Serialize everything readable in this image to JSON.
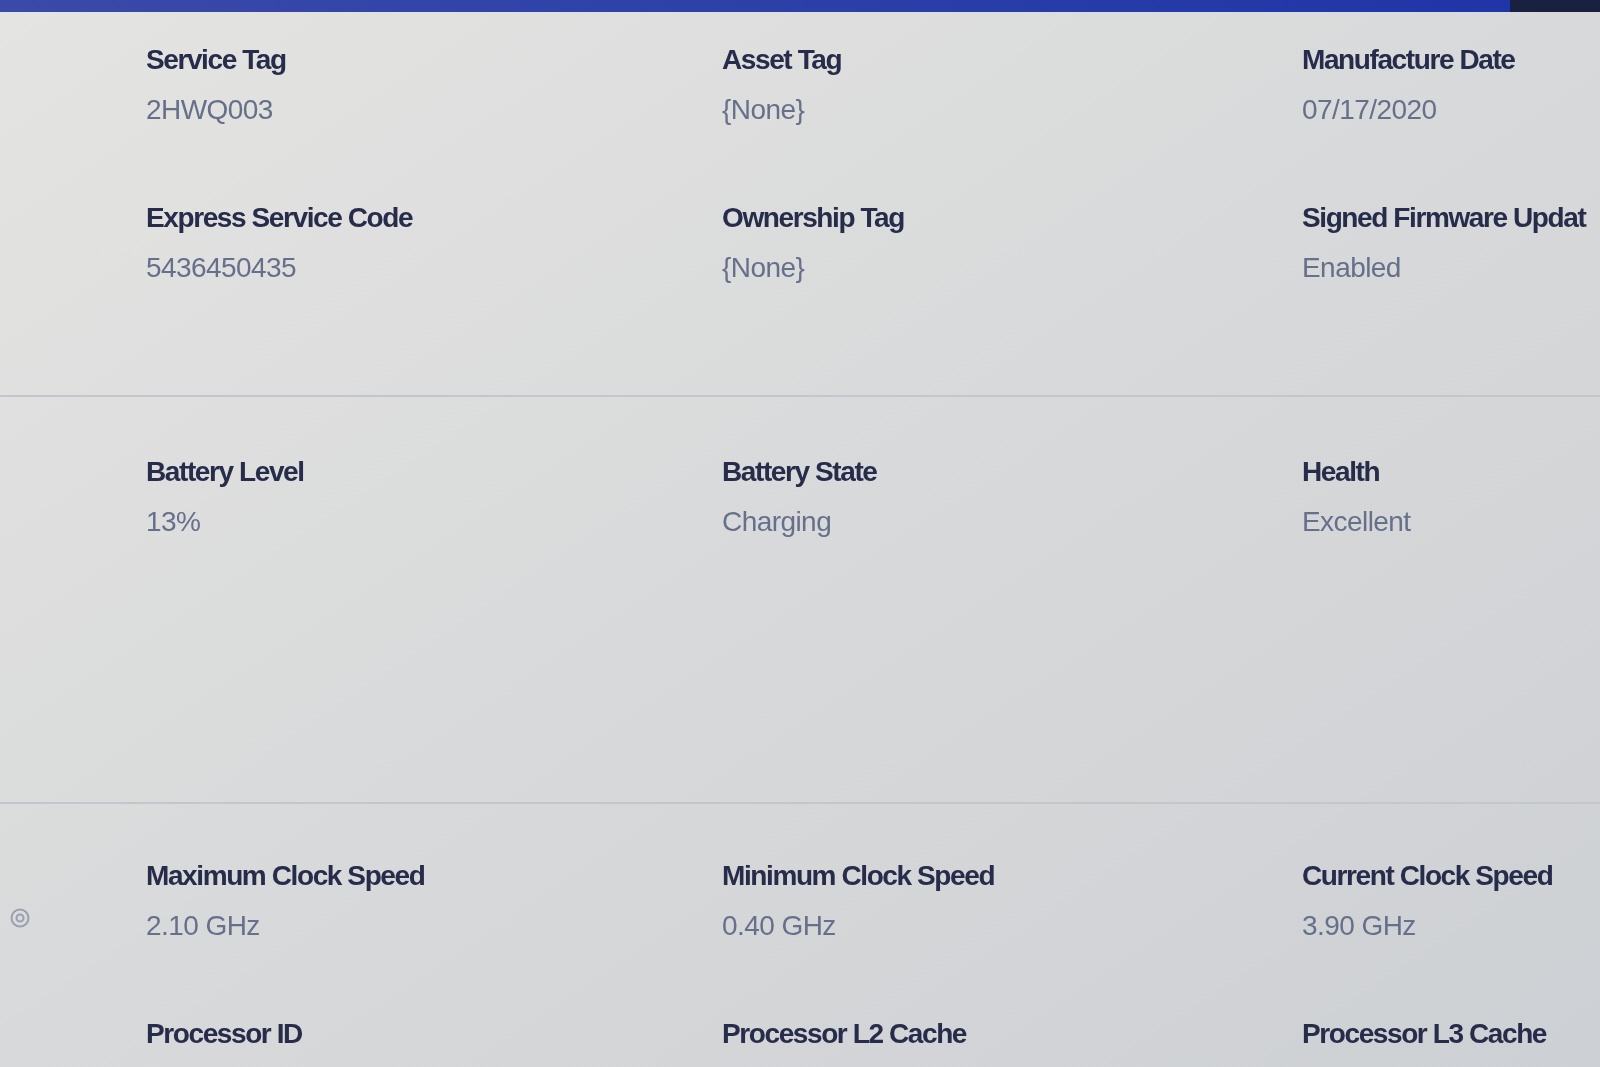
{
  "sections": [
    {
      "rows": [
        [
          {
            "label": "Service Tag",
            "value": "2HWQ003"
          },
          {
            "label": "Asset Tag",
            "value": "{None}"
          },
          {
            "label": "Manufacture Date",
            "value": "07/17/2020"
          }
        ],
        [
          {
            "label": "Express Service Code",
            "value": "5436450435"
          },
          {
            "label": "Ownership Tag",
            "value": "{None}"
          },
          {
            "label": "Signed Firmware Updat",
            "value": "Enabled"
          }
        ]
      ]
    },
    {
      "rows": [
        [
          {
            "label": "Battery Level",
            "value": "13%"
          },
          {
            "label": "Battery State",
            "value": "Charging"
          },
          {
            "label": "Health",
            "value": "Excellent"
          }
        ]
      ]
    },
    {
      "rows": [
        [
          {
            "label": "Maximum Clock Speed",
            "value": "2.10 GHz"
          },
          {
            "label": "Minimum Clock Speed",
            "value": "0.40 GHz"
          },
          {
            "label": "Current Clock Speed",
            "value": "3.90 GHz"
          }
        ],
        [
          {
            "label": "Processor ID"
          },
          {
            "label": "Processor L2 Cache"
          },
          {
            "label": "Processor L3 Cache"
          }
        ]
      ]
    }
  ]
}
